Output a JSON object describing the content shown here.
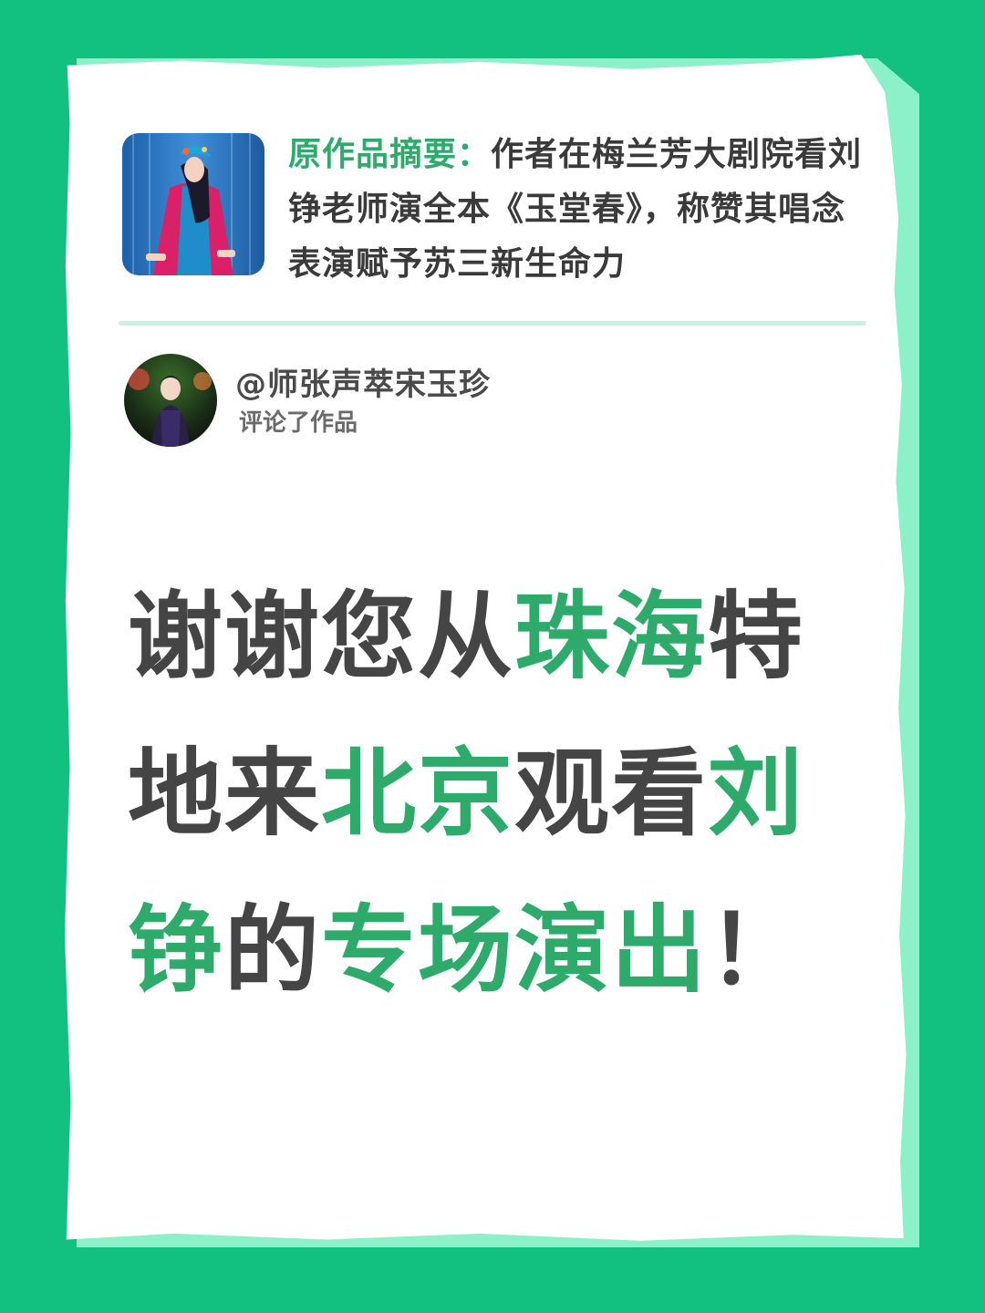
{
  "summary": {
    "label": "原作品摘要：",
    "text": "作者在梅兰芳大剧院看刘铮老师演全本《玉堂春》，称赞其唱念表演赋予苏三新生命力"
  },
  "comment": {
    "username": "@师张声萃宋玉珍",
    "action": "评论了作品"
  },
  "message": {
    "line1": [
      {
        "text": "谢谢您从",
        "highlight": false
      },
      {
        "text": "珠海",
        "highlight": true
      },
      {
        "text": "特",
        "highlight": false
      }
    ],
    "line2": [
      {
        "text": "地来",
        "highlight": false
      },
      {
        "text": "北京",
        "highlight": true
      },
      {
        "text": "观看",
        "highlight": false
      },
      {
        "text": "刘",
        "highlight": true
      }
    ],
    "line3": [
      {
        "text": "铮",
        "highlight": true
      },
      {
        "text": "的",
        "highlight": false
      },
      {
        "text": "专场演出",
        "highlight": true
      },
      {
        "text": "！",
        "highlight": false
      }
    ]
  },
  "colors": {
    "background": "#12c17f",
    "accent": "#2eab6b",
    "text": "#454545"
  }
}
